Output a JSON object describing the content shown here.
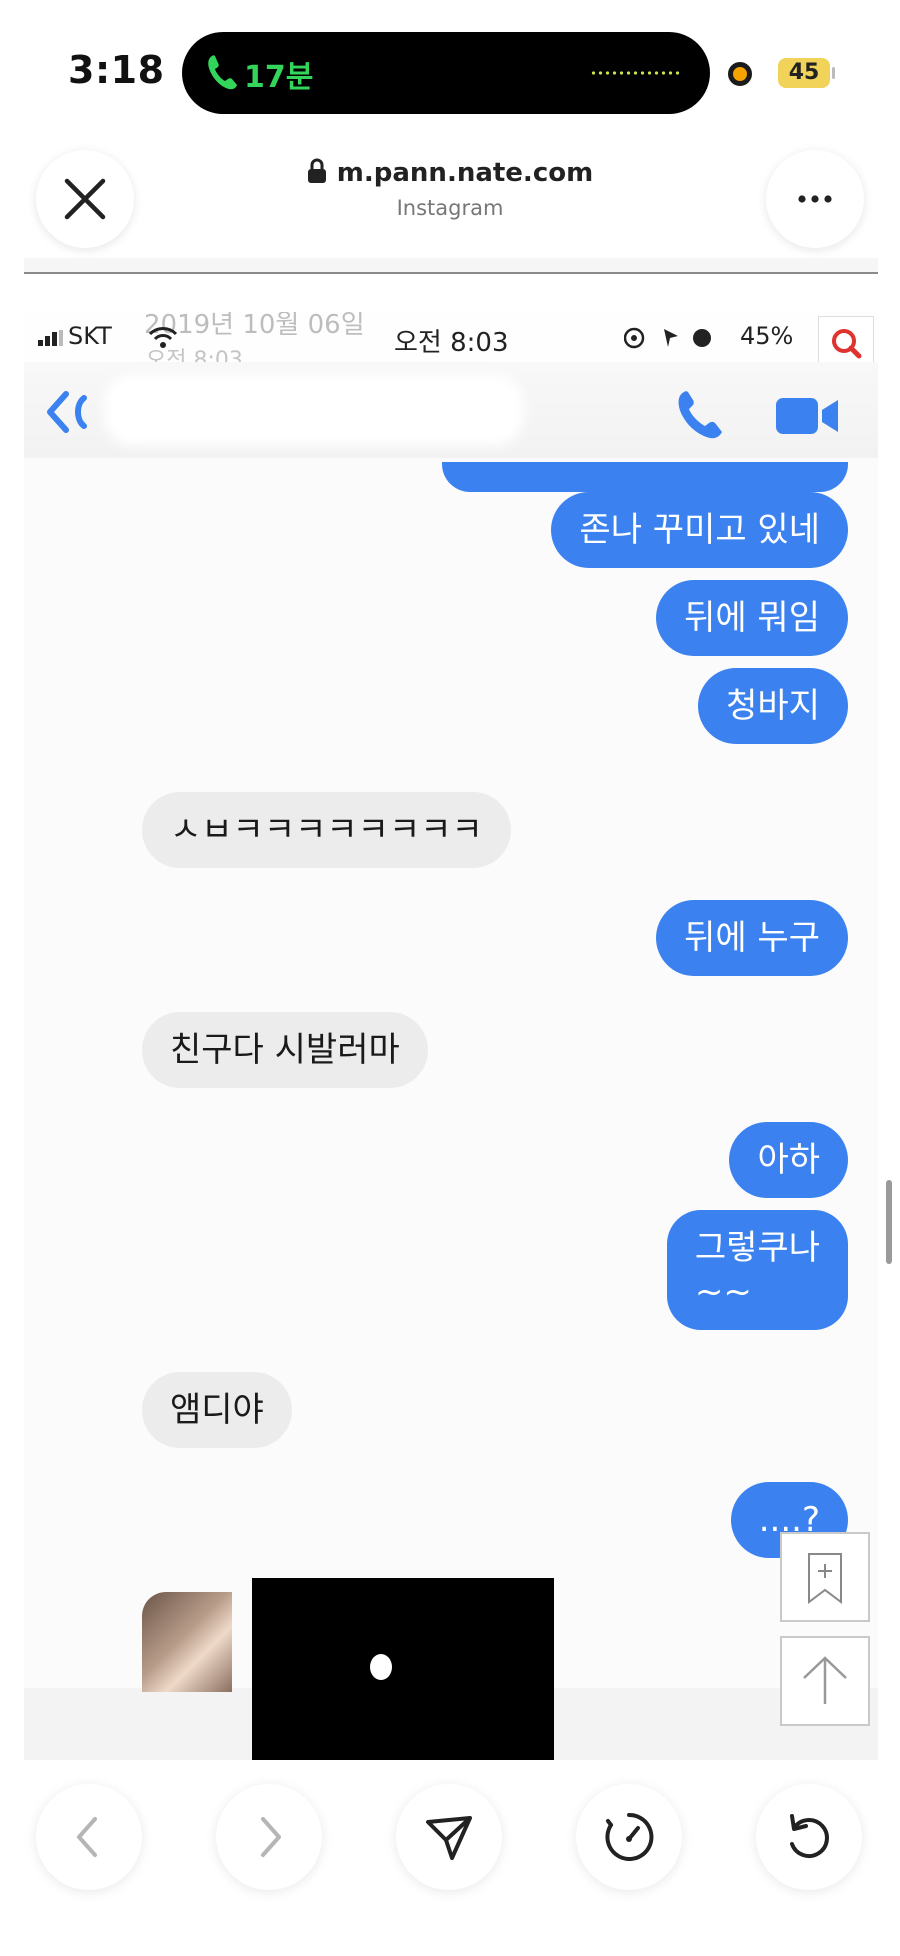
{
  "status_bar": {
    "time": "3:18",
    "call_duration": "17분",
    "battery": "45"
  },
  "browser": {
    "url": "m.pann.nate.com",
    "subtitle": "Instagram",
    "close_icon": "close-icon",
    "more_icon": "more-icon"
  },
  "screenshot": {
    "status": {
      "carrier": "SKT",
      "clock": "오전 8:03",
      "battery": "45%"
    },
    "ghost_date": "2019년 10월 06일",
    "ghost_time": "오전 8:03",
    "messages": [
      {
        "dir": "out",
        "text": "존나 꾸미고 있네"
      },
      {
        "dir": "out",
        "text": "뒤에 뭐임"
      },
      {
        "dir": "out",
        "text": "청바지"
      },
      {
        "dir": "in",
        "text": "ㅅㅂㅋㅋㅋㅋㅋㅋㅋㅋ"
      },
      {
        "dir": "out",
        "text": "뒤에 누구"
      },
      {
        "dir": "in",
        "text": "친구다 시발러마"
      },
      {
        "dir": "out",
        "text": "아하"
      },
      {
        "dir": "out",
        "text": "그렇쿠나\n~~"
      },
      {
        "dir": "in",
        "text": "앰디야"
      },
      {
        "dir": "out",
        "text": "....?"
      }
    ],
    "colors": {
      "outgoing": "#3b82f0",
      "incoming": "#ececec"
    }
  },
  "toolbar": {
    "items": [
      "back-icon",
      "forward-icon",
      "share-icon",
      "speed-icon",
      "reload-icon"
    ]
  }
}
